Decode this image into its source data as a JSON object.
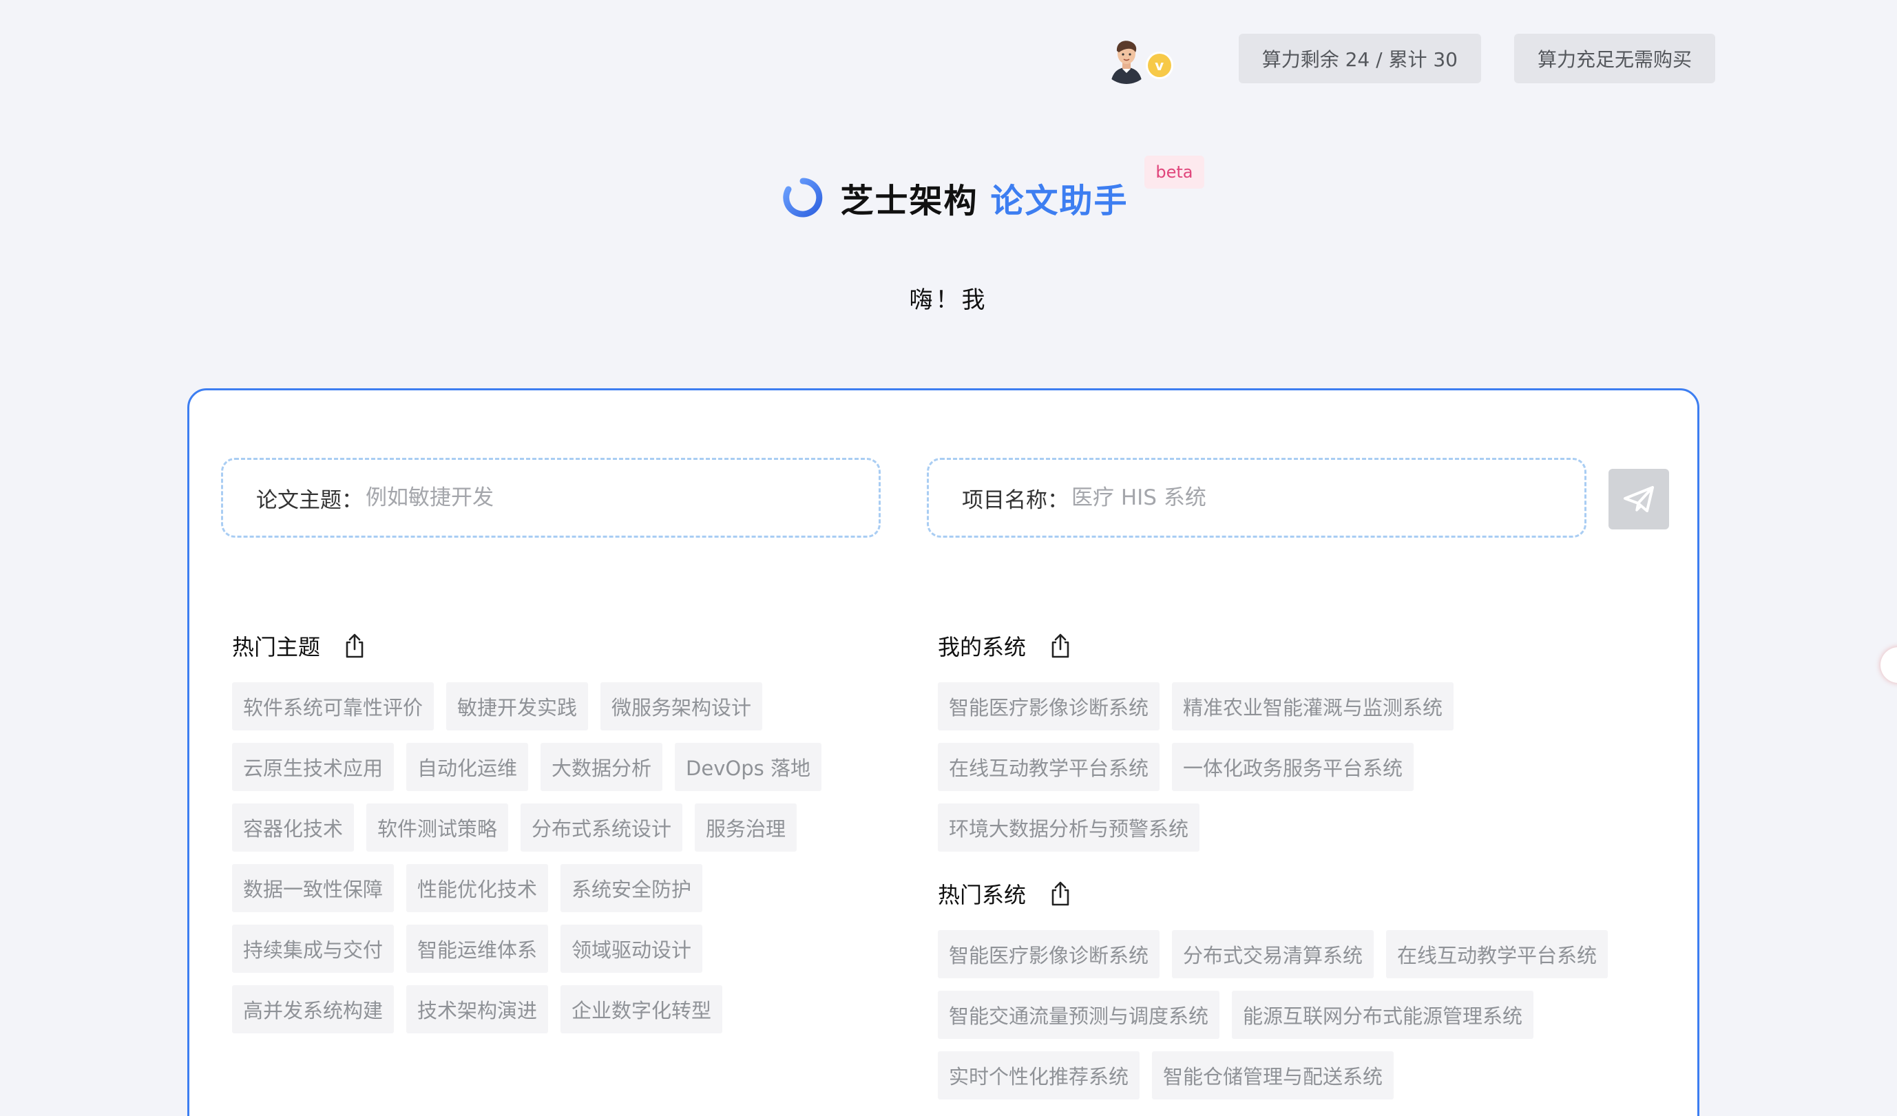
{
  "topbar": {
    "avatar_badge": "v",
    "quota_label": "算力剩余 24 / 累计 30",
    "buy_label": "算力充足无需购买"
  },
  "header": {
    "brand_name": "芝士架构",
    "brand_sub": "论文助手",
    "badge": "beta",
    "greeting": "嗨！我"
  },
  "form": {
    "topic_label": "论文主题：",
    "topic_placeholder": "例如敏捷开发",
    "project_label": "项目名称：",
    "project_placeholder": "医疗 HIS 系统"
  },
  "hot_topics": {
    "title": "热门主题",
    "items": [
      "软件系统可靠性评价",
      "敏捷开发实践",
      "微服务架构设计",
      "云原生技术应用",
      "自动化运维",
      "大数据分析",
      "DevOps 落地",
      "容器化技术",
      "软件测试策略",
      "分布式系统设计",
      "服务治理",
      "数据一致性保障",
      "性能优化技术",
      "系统安全防护",
      "持续集成与交付",
      "智能运维体系",
      "领域驱动设计",
      "高并发系统构建",
      "技术架构演进",
      "企业数字化转型"
    ]
  },
  "my_systems": {
    "title": "我的系统",
    "items": [
      "智能医疗影像诊断系统",
      "精准农业智能灌溉与监测系统",
      "在线互动教学平台系统",
      "一体化政务服务平台系统",
      "环境大数据分析与预警系统"
    ]
  },
  "hot_systems": {
    "title": "热门系统",
    "items": [
      "智能医疗影像诊断系统",
      "分布式交易清算系统",
      "在线互动教学平台系统",
      "智能交通流量预测与调度系统",
      "能源互联网分布式能源管理系统",
      "实时个性化推荐系统",
      "智能仓储管理与配送系统"
    ]
  },
  "colors": {
    "accent": "#3d7ef1",
    "beta_bg": "#fde9ee",
    "beta_text": "#e0457b",
    "tag_bg": "#f4f4f6",
    "tag_text": "#8f9297"
  }
}
